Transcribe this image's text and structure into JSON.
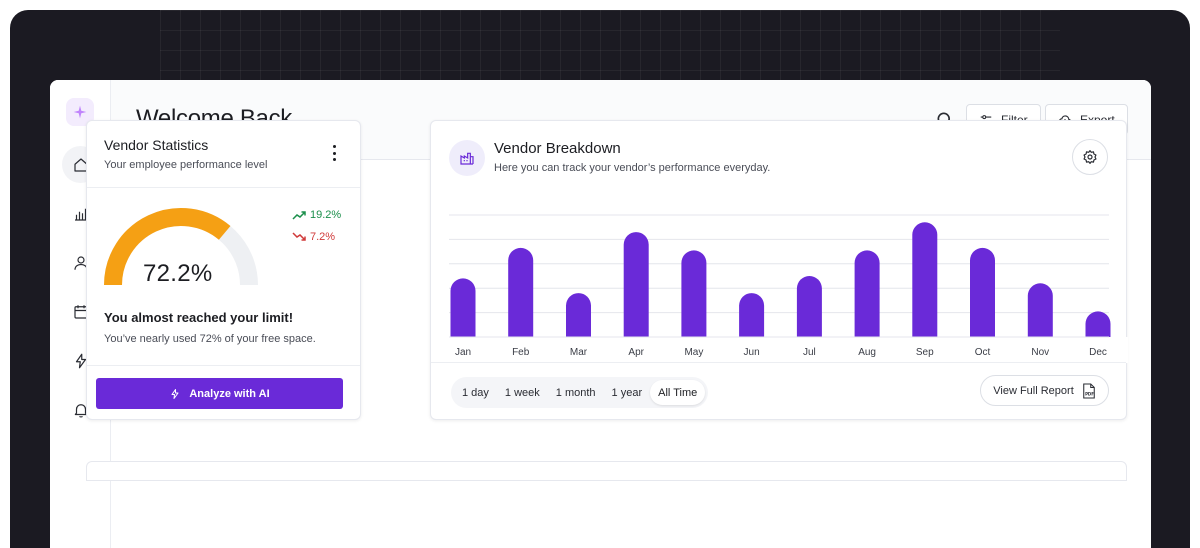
{
  "header": {
    "title": "Welcome Back",
    "filter_label": "Filter",
    "export_label": "Export"
  },
  "sidebar": {
    "items": [
      {
        "icon": "home-icon",
        "active": true
      },
      {
        "icon": "bar-chart-icon",
        "active": false
      },
      {
        "icon": "user-icon",
        "active": false
      },
      {
        "icon": "calendar-icon",
        "active": false
      },
      {
        "icon": "bolt-icon",
        "active": false
      },
      {
        "icon": "bell-icon",
        "active": false
      }
    ]
  },
  "vendor_stats": {
    "title": "Vendor Statistics",
    "subtitle": "Your employee performance level",
    "gauge_value": "72.2%",
    "gauge_fraction": 0.722,
    "trend_up": "19.2%",
    "trend_down": "7.2%",
    "heading": "You almost reached your limit!",
    "message": "You’ve nearly used 72% of your free space.",
    "ai_button": "Analyze with AI"
  },
  "vendor_breakdown": {
    "title": "Vendor Breakdown",
    "subtitle": "Here you can track your vendor’s performance everyday.",
    "ranges": [
      "1 day",
      "1 week",
      "1 month",
      "1 year",
      "All Time"
    ],
    "selected_range": "All Time",
    "report_button": "View Full Report"
  },
  "colors": {
    "accent": "#6a2ad8",
    "gauge": "#f5a014",
    "gauge_track": "#eef0f3",
    "up": "#1b8f4b",
    "down": "#d03a3a"
  },
  "chart_data": {
    "type": "bar",
    "categories": [
      "Jan",
      "Feb",
      "Mar",
      "Apr",
      "May",
      "Jun",
      "Jul",
      "Aug",
      "Sep",
      "Oct",
      "Nov",
      "Dec"
    ],
    "values": [
      48,
      73,
      36,
      86,
      71,
      36,
      50,
      71,
      94,
      73,
      44,
      21
    ],
    "ylim": [
      0,
      100
    ],
    "grid": true
  }
}
